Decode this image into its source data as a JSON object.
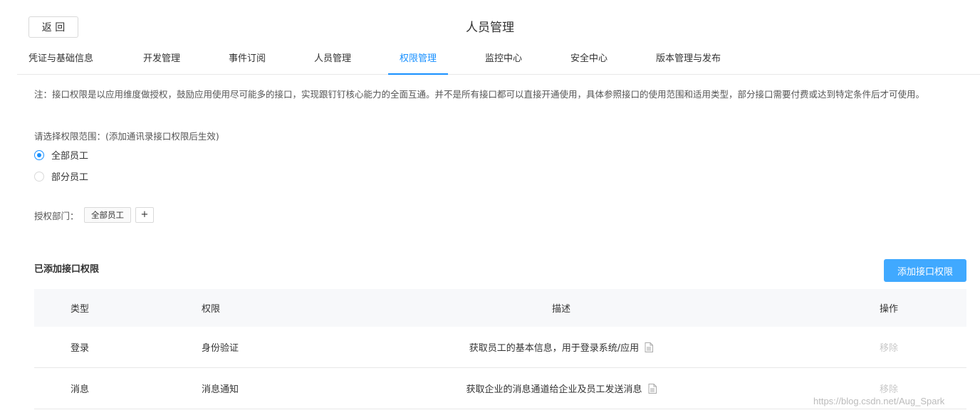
{
  "header": {
    "back_label": "返 回",
    "title": "人员管理"
  },
  "tabs": [
    {
      "label": "凭证与基础信息"
    },
    {
      "label": "开发管理"
    },
    {
      "label": "事件订阅"
    },
    {
      "label": "人员管理"
    },
    {
      "label": "权限管理",
      "active": true
    },
    {
      "label": "监控中心"
    },
    {
      "label": "安全中心"
    },
    {
      "label": "版本管理与发布"
    }
  ],
  "note": "注：接口权限是以应用维度做授权，鼓励应用使用尽可能多的接口，实现跟钉钉核心能力的全面互通。并不是所有接口都可以直接开通使用，具体参照接口的使用范围和适用类型，部分接口需要付费或达到特定条件后才可使用。",
  "scope": {
    "label": "请选择权限范围：(添加通讯录接口权限后生效)",
    "options": [
      {
        "label": "全部员工",
        "checked": true
      },
      {
        "label": "部分员工",
        "checked": false
      }
    ]
  },
  "departments": {
    "label": "授权部门：",
    "tag": "全部员工",
    "add": "+"
  },
  "permissions": {
    "title": "已添加接口权限",
    "add_button": "添加接口权限",
    "columns": [
      "类型",
      "权限",
      "描述",
      "操作"
    ],
    "rows": [
      {
        "type": "登录",
        "permission": "身份验证",
        "description": "获取员工的基本信息，用于登录系统/应用",
        "action": "移除"
      },
      {
        "type": "消息",
        "permission": "消息通知",
        "description": "获取企业的消息通道给企业及员工发送消息",
        "action": "移除"
      }
    ]
  },
  "watermark": "https://blog.csdn.net/Aug_Spark",
  "colors": {
    "accent": "#1890ff",
    "button": "#40a9ff"
  }
}
